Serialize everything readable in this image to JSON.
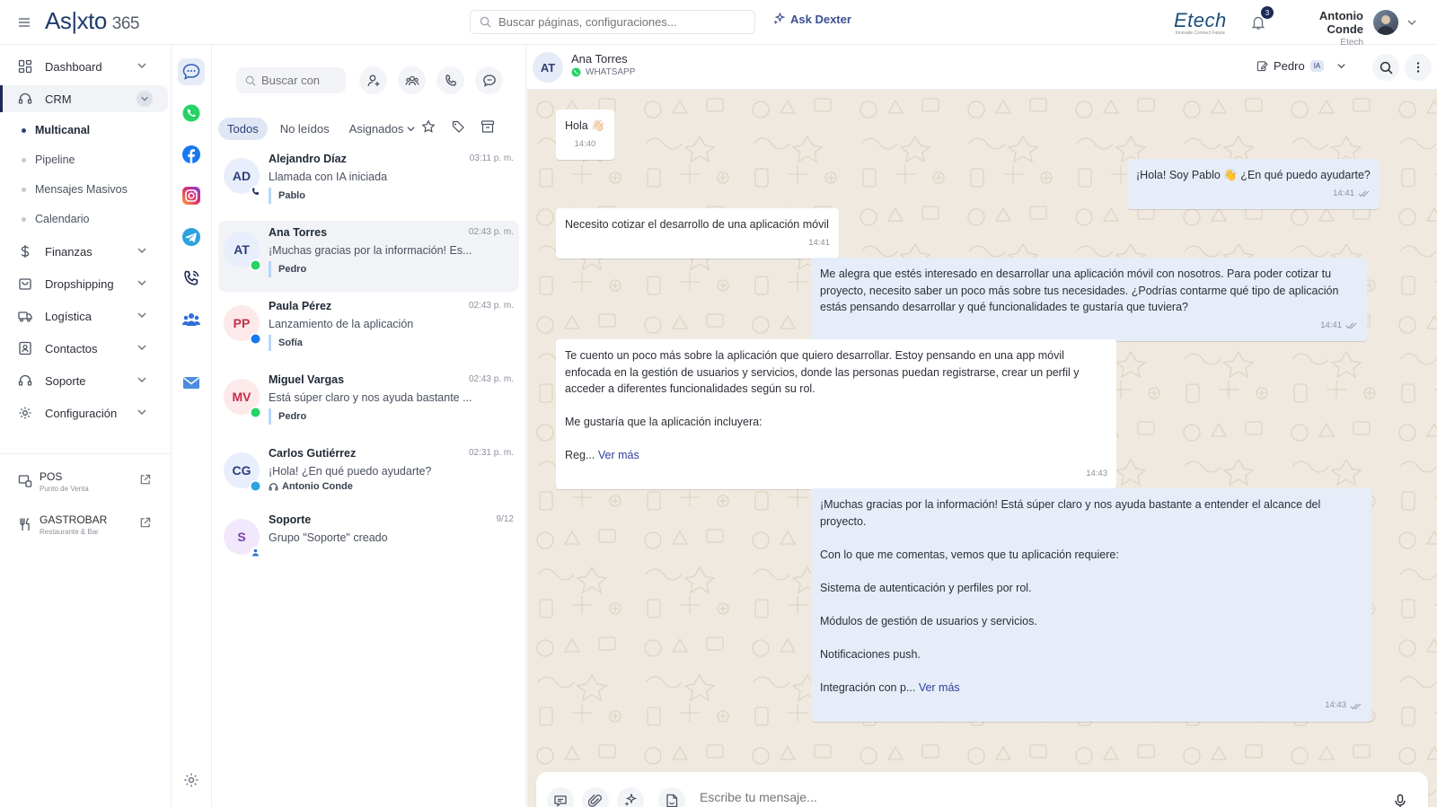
{
  "topbar": {
    "logo_main": "As|xto",
    "logo_num": "365",
    "search_placeholder": "Buscar páginas, configuraciones...",
    "ask_label": "Ask Dexter",
    "brand": "Etech",
    "brand_tag": "Innovate Connect Future",
    "notif_count": "3",
    "user_name": "Antonio Conde",
    "user_company": "Etech"
  },
  "sidebar": {
    "items": [
      {
        "label": "Dashboard",
        "icon": "dashboard-icon"
      },
      {
        "label": "CRM",
        "icon": "headset-icon"
      },
      {
        "label": "Finanzas",
        "icon": "dollar-icon"
      },
      {
        "label": "Dropshipping",
        "icon": "bag-icon"
      },
      {
        "label": "Logística",
        "icon": "truck-icon"
      },
      {
        "label": "Contactos",
        "icon": "contacts-icon"
      },
      {
        "label": "Soporte",
        "icon": "headset-icon"
      },
      {
        "label": "Configuración",
        "icon": "gear-icon"
      }
    ],
    "crm_sub": [
      "Multicanal",
      "Pipeline",
      "Mensajes Masivos",
      "Calendario"
    ],
    "apps": [
      {
        "name": "POS",
        "sub": "Punto de Venta"
      },
      {
        "name": "GASTROBAR",
        "sub": "Restaurante & Bar"
      }
    ]
  },
  "channels": [
    "chat-icon",
    "whatsapp-icon",
    "facebook-icon",
    "instagram-icon",
    "telegram-icon",
    "phone-icon",
    "groups-icon",
    "email-icon"
  ],
  "convlist": {
    "search_placeholder": "Buscar con",
    "filters": {
      "all": "Todos",
      "unread": "No leídos",
      "assigned": "Asignados"
    },
    "items": [
      {
        "initials": "AD",
        "name": "Alejandro Díaz",
        "time": "03:11 p. m.",
        "preview": "Llamada con IA iniciada",
        "agent": "Pablo",
        "channel": "phone",
        "color": "#e8eefb",
        "textcolor": "#2f3e77"
      },
      {
        "initials": "AT",
        "name": "Ana Torres",
        "time": "02:43 p. m.",
        "preview": "¡Muchas gracias por la información! Es...",
        "agent": "Pedro",
        "channel": "whatsapp",
        "color": "#e8eefb",
        "textcolor": "#2f3e77"
      },
      {
        "initials": "PP",
        "name": "Paula Pérez",
        "time": "02:43 p. m.",
        "preview": "Lanzamiento de la aplicación",
        "agent": "Sofía",
        "channel": "facebook",
        "color": "#fde8ea",
        "textcolor": "#c0304a"
      },
      {
        "initials": "MV",
        "name": "Miguel Vargas",
        "time": "02:43 p. m.",
        "preview": "Está súper claro y nos ayuda bastante ...",
        "agent": "Pedro",
        "channel": "whatsapp",
        "color": "#fde8ea",
        "textcolor": "#c0304a"
      },
      {
        "initials": "CG",
        "name": "Carlos Gutiérrez",
        "time": "02:31 p. m.",
        "preview": "¡Hola! ¿En qué puedo ayudarte?",
        "agent": "Antonio Conde",
        "channel": "telegram",
        "color": "#e8eefb",
        "textcolor": "#2f3e77"
      },
      {
        "initials": "S",
        "name": "Soporte",
        "time": "9/12",
        "preview": "Grupo \"Soporte\" creado",
        "agent": "",
        "channel": "group",
        "color": "#f1e8fb",
        "textcolor": "#7b3fb0"
      }
    ]
  },
  "chat": {
    "contact_initials": "AT",
    "contact_name": "Ana Torres",
    "channel_label": "WHATSAPP",
    "agent": "Pedro",
    "agent_tag": "IA",
    "composer_placeholder": "Escribe tu mensaje...",
    "see_more": "Ver más",
    "messages": {
      "m1": {
        "text": "Hola 👋🏻",
        "time": "14:40"
      },
      "m2": {
        "text": "¡Hola! Soy Pablo 👋 ¿En qué puedo ayudarte?",
        "time": "14:41"
      },
      "m3": {
        "text": "Necesito cotizar el desarrollo de una aplicación móvil",
        "time": "14:41"
      },
      "m4": {
        "text": "Me alegra que estés interesado en desarrollar una aplicación móvil con nosotros. Para poder cotizar tu proyecto, necesito saber un poco más sobre tus necesidades. ¿Podrías contarme qué tipo de aplicación estás pensando desarrollar y qué funcionalidades te gustaría que tuviera?",
        "time": "14:41"
      },
      "m5": {
        "p1": "Te cuento un poco más sobre la aplicación que quiero desarrollar. Estoy pensando en una app móvil enfocada en la gestión de usuarios y servicios, donde las personas puedan registrarse, crear un perfil y acceder a diferentes funcionalidades según su rol.",
        "p2": "Me gustaría que la aplicación incluyera:",
        "p3": "Reg...",
        "time": "14:43"
      },
      "m6": {
        "p1": "¡Muchas gracias por la información! Está súper claro y nos ayuda bastante a entender el alcance del proyecto.",
        "p2": "Con lo que me comentas, vemos que tu aplicación requiere:",
        "p3": "Sistema de autenticación y perfiles por rol.",
        "p4": "Módulos de gestión de usuarios y servicios.",
        "p5": "Notificaciones push.",
        "p6": "Integración con p...",
        "time": "14:43"
      }
    }
  }
}
